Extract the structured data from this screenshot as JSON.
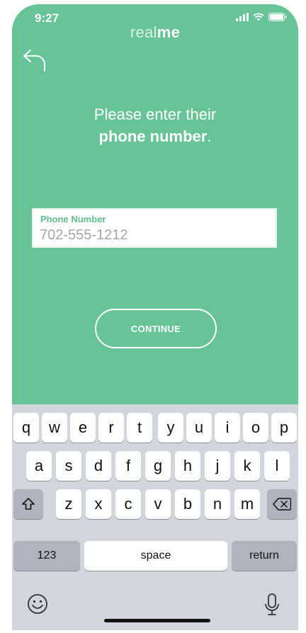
{
  "status_bar": {
    "time": "9:27"
  },
  "brand": {
    "light": "real",
    "bold": "me"
  },
  "prompt": {
    "line1": "Please enter their",
    "bold": "phone number",
    "period": "."
  },
  "phone_field": {
    "label": "Phone Number",
    "value": "",
    "placeholder": "702-555-1212"
  },
  "continue_label": "CONTINUE",
  "keyboard": {
    "row1": [
      "q",
      "w",
      "e",
      "r",
      "t",
      "y",
      "u",
      "i",
      "o",
      "p"
    ],
    "row2": [
      "a",
      "s",
      "d",
      "f",
      "g",
      "h",
      "j",
      "k",
      "l"
    ],
    "row3": [
      "z",
      "x",
      "c",
      "v",
      "b",
      "n",
      "m"
    ],
    "numbers_label": "123",
    "space_label": "space",
    "return_label": "return"
  },
  "icons": [
    "signal-icon",
    "wifi-icon",
    "battery-icon",
    "back-arrow-icon",
    "shift-icon",
    "delete-icon",
    "emoji-icon",
    "microphone-icon"
  ]
}
